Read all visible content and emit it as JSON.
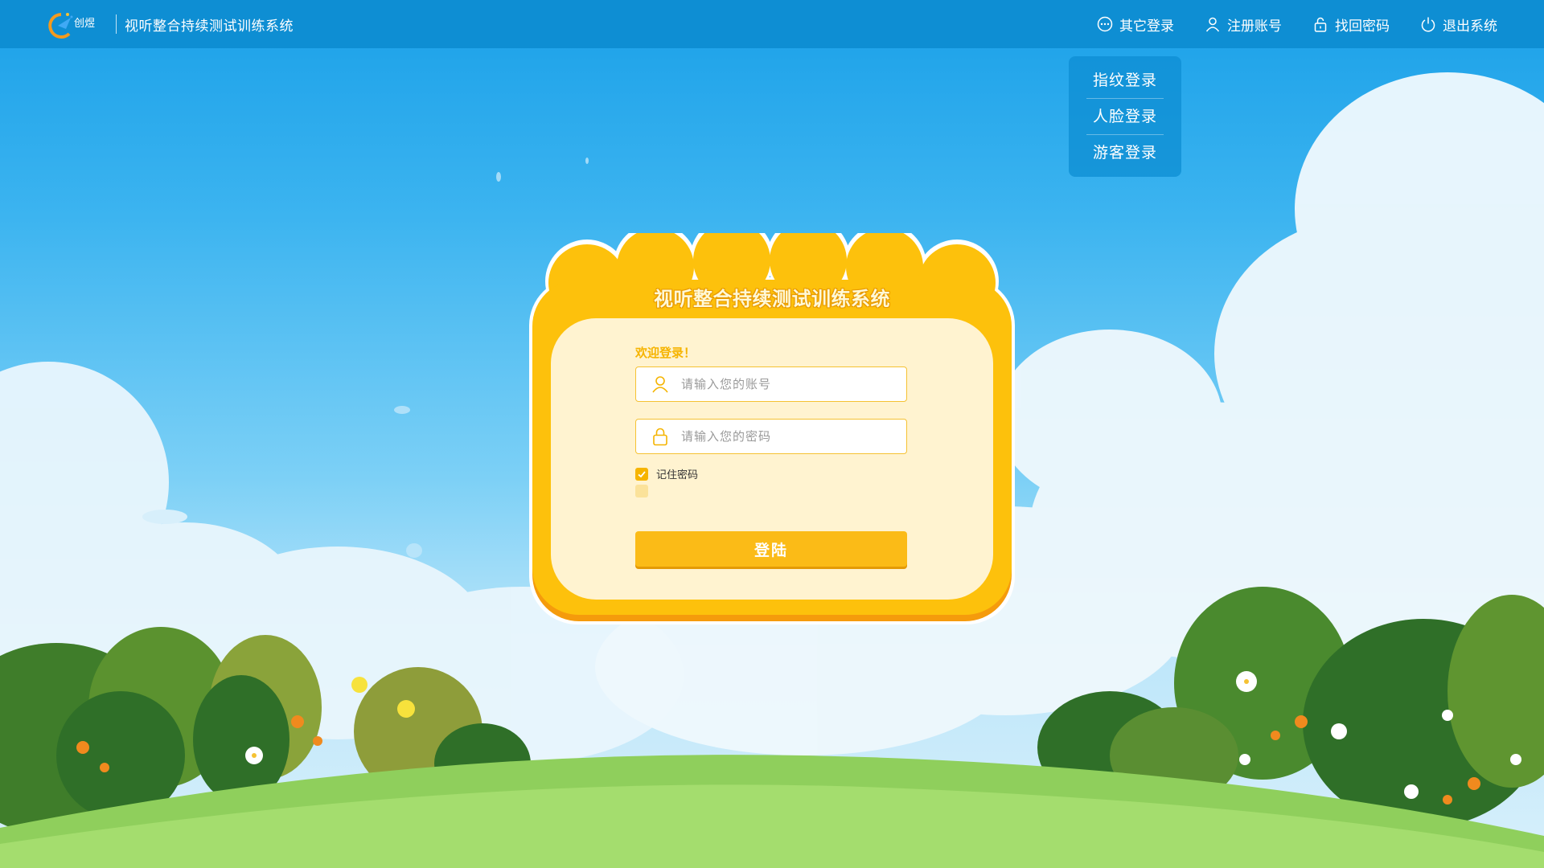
{
  "app": {
    "logo_text": "创煜",
    "title": "视听整合持续测试训练系统"
  },
  "nav": {
    "items": [
      {
        "label": "其它登录",
        "icon": "more-circle-icon"
      },
      {
        "label": "注册账号",
        "icon": "user-icon"
      },
      {
        "label": "找回密码",
        "icon": "lock-icon"
      },
      {
        "label": "退出系统",
        "icon": "power-icon"
      }
    ]
  },
  "dropdown": {
    "items": [
      {
        "label": "指纹登录"
      },
      {
        "label": "人脸登录"
      },
      {
        "label": "游客登录"
      }
    ]
  },
  "login": {
    "title": "视听整合持续测试训练系统",
    "welcome": "欢迎登录！",
    "account_placeholder": "请输入您的账号",
    "password_placeholder": "请输入您的密码",
    "remember_label": "记住密码",
    "remember_checked": true,
    "submit_label": "登陆"
  },
  "colors": {
    "topbar": "#0e8ed3",
    "accent_yellow": "#fbbb17",
    "card_inner": "#fff3d0"
  }
}
